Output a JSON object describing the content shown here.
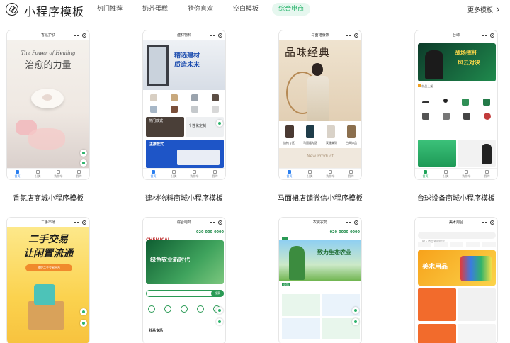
{
  "header": {
    "brand": "小程序模板",
    "tabs": [
      {
        "label": "热门推荐",
        "active": false
      },
      {
        "label": "奶茶蛋糕",
        "active": false
      },
      {
        "label": "猜你喜欢",
        "active": false
      },
      {
        "label": "空白模板",
        "active": false
      },
      {
        "label": "综合电商",
        "active": true
      }
    ],
    "more": "更多模板"
  },
  "tabbar": [
    "首页",
    "分类",
    "购物车",
    "我的"
  ],
  "cards": [
    {
      "phone_title": "香氛护肤",
      "caption": "香氛店商城小程序模板",
      "banner_title": "治愈的力量",
      "banner_sub": "The Power of Healing"
    },
    {
      "phone_title": "建材物料",
      "caption": "建材物料商城小程序模板",
      "banner_title": "精选建材",
      "banner_title2": "质造未来",
      "section1": "热门款式",
      "section2": "个性化定制",
      "section3": "主推款式"
    },
    {
      "phone_title": "马面裙服饰",
      "caption": "马面裙店铺微信小程序模板",
      "banner_title": "品味经典",
      "labels": [
        "旗袍专区",
        "马面裙专区",
        "汉服集锦",
        "古典饰品"
      ],
      "footer": "New Product"
    },
    {
      "phone_title": "台球",
      "caption": "台球设备商城小程序模板",
      "banner_title": "战场挥杆",
      "banner_title2": "风云对决",
      "notice": "新品上架"
    },
    {
      "phone_title": "二手市场",
      "banner_title": "二手交易",
      "banner_title2": "让闲置流通",
      "button": "捕捉二手交易平台"
    },
    {
      "phone_title": "综合电商",
      "logo": "CHEMICAL",
      "phone": "020-000-0000",
      "banner_title": "绿色农业新时代",
      "search_btn": "搜索",
      "section": "秒杀专场"
    },
    {
      "phone_title": "农资农药",
      "phone": "020-0000-0000",
      "banner_title": "致力生态农业",
      "notice": "公告"
    },
    {
      "phone_title": "美术用品",
      "search": "输入商品名称搜索",
      "banner_title": "美术用品"
    }
  ],
  "colors": {
    "accent": "#25b36a",
    "accent_bg": "#e6f7ef",
    "tab_active": "#2a7ff0"
  }
}
